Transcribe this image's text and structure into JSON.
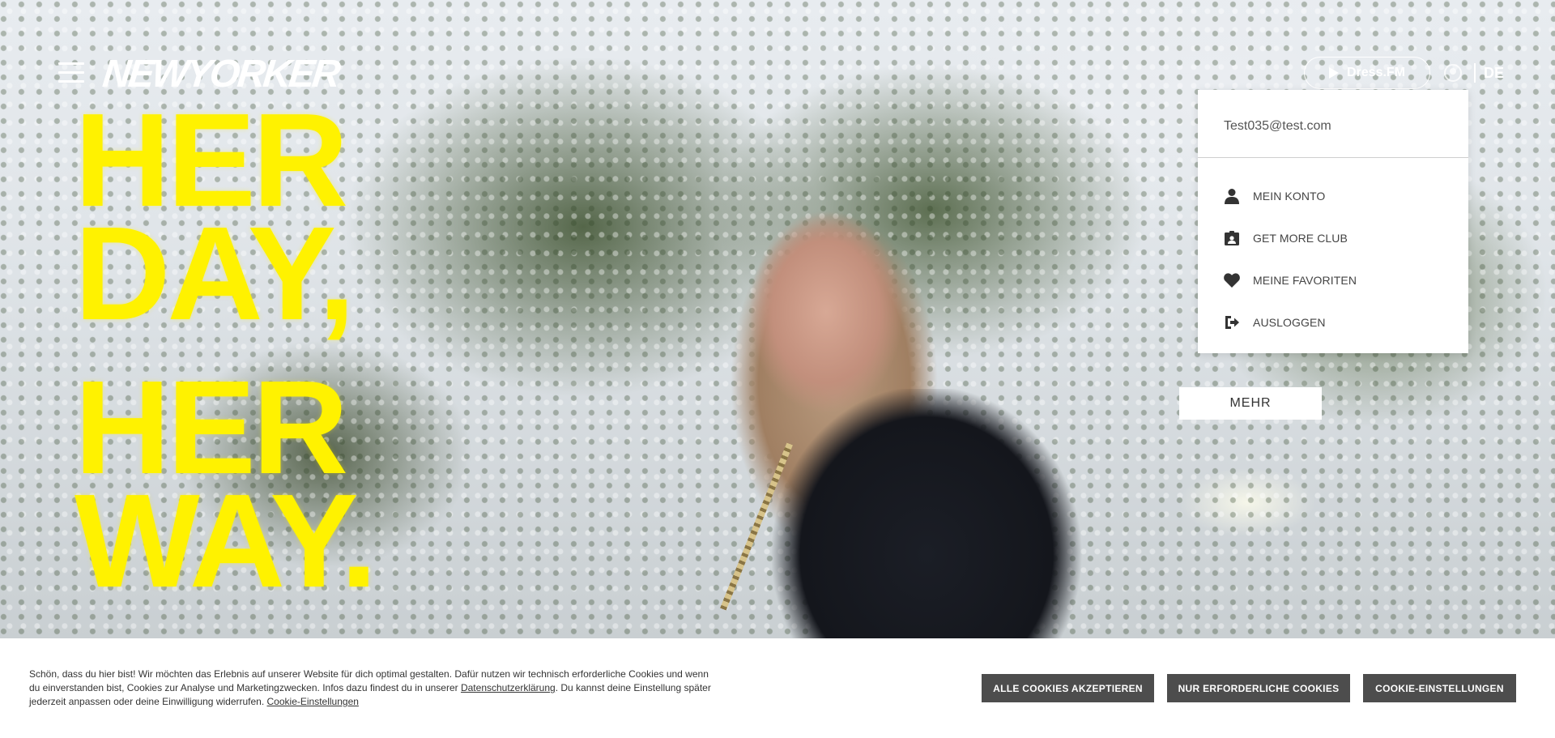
{
  "header": {
    "logo_text": "NEWYORKER",
    "dress_fm_label": "Dress.FM",
    "language": "DE"
  },
  "hero": {
    "headline_lines": [
      "HER",
      "DAY,",
      "HER",
      "WAY."
    ],
    "more_button": "MEHR"
  },
  "account_menu": {
    "email": "Test035@test.com",
    "items": [
      {
        "label": "MEIN KONTO",
        "icon": "person-icon"
      },
      {
        "label": "GET MORE CLUB",
        "icon": "id-card-icon"
      },
      {
        "label": "MEINE FAVORITEN",
        "icon": "heart-icon"
      },
      {
        "label": "AUSLOGGEN",
        "icon": "logout-icon"
      }
    ]
  },
  "cookie_banner": {
    "text_part1": "Schön, dass du hier bist! Wir möchten das Erlebnis auf unserer Website für dich optimal gestalten. Dafür nutzen wir technisch erforderliche Cookies und wenn du einverstanden bist, Cookies zur Analyse und Marketingzwecken. Infos dazu findest du in unserer ",
    "privacy_link": "Datenschutzerklärung",
    "text_part2": ". Du kannst deine Einstellung später jederzeit anpassen oder deine Einwilligung widerrufen. ",
    "settings_link": "Cookie-Einstellungen",
    "buttons": {
      "accept_all": "ALLE COOKIES AKZEPTIEREN",
      "necessary_only": "NUR ERFORDERLICHE COOKIES",
      "settings": "COOKIE-EINSTELLUNGEN"
    }
  },
  "colors": {
    "headline_yellow": "#fff200",
    "button_gray": "#4d4d4d"
  }
}
